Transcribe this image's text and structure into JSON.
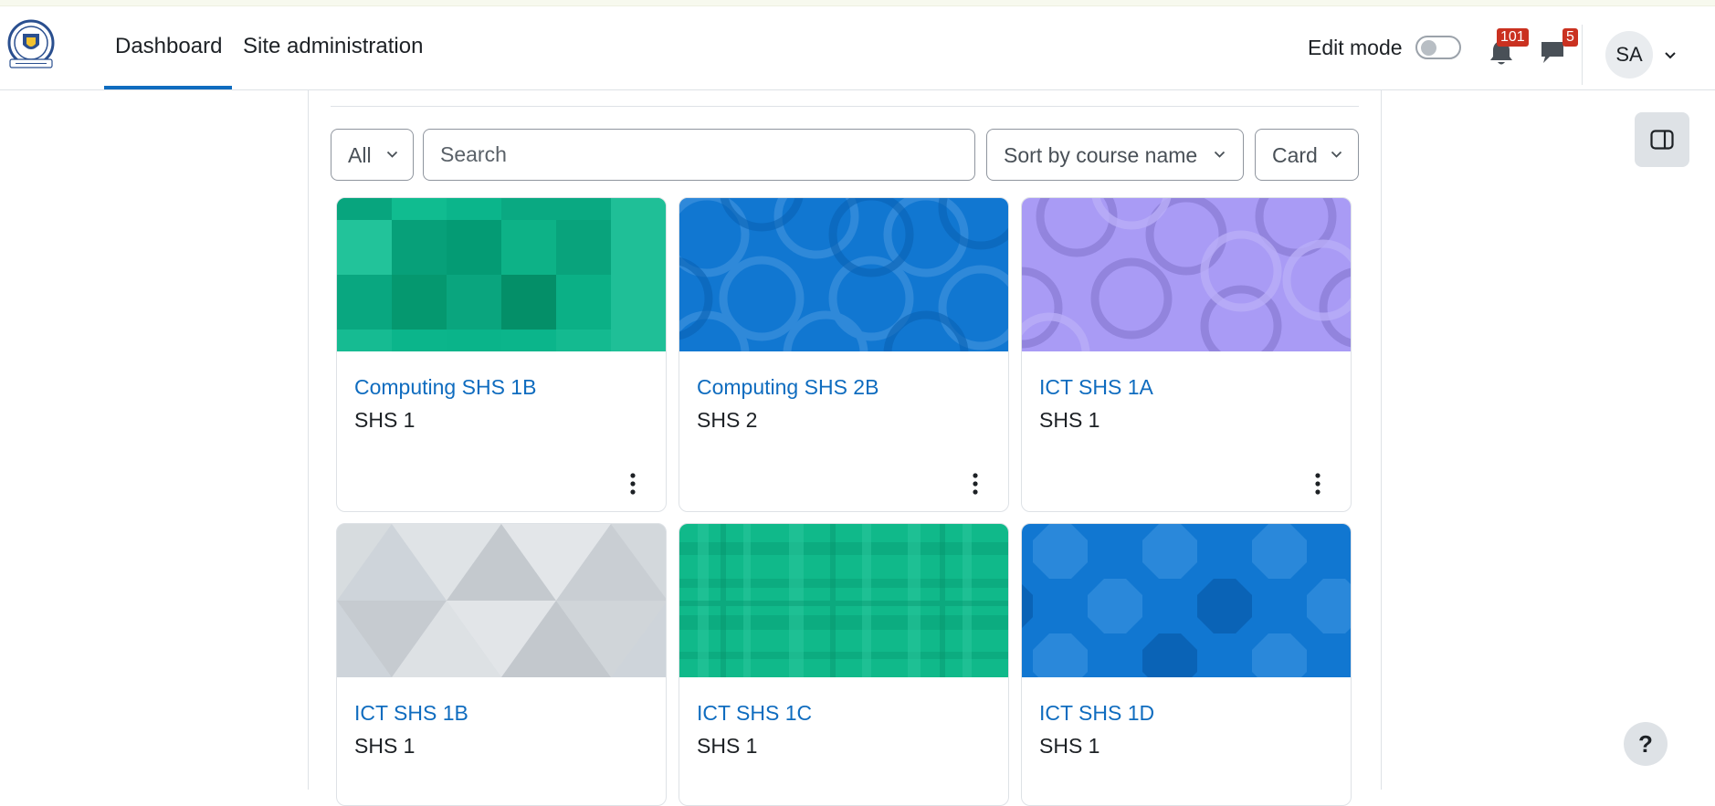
{
  "header": {
    "logo_icon": "school-crest-logo",
    "nav": [
      {
        "label": "Dashboard",
        "active": true
      },
      {
        "label": "Site administration",
        "active": false
      }
    ],
    "edit_mode_label": "Edit mode",
    "edit_mode_on": false,
    "notifications_count": "101",
    "messages_count": "5",
    "user_initials": "SA"
  },
  "filters": {
    "grouping": "All",
    "search_placeholder": "Search",
    "sort": "Sort by course name",
    "view": "Card"
  },
  "courses": [
    {
      "name": "Computing SHS 1B",
      "category": "SHS 1",
      "pattern": "squares-green",
      "color": "#0bb58b"
    },
    {
      "name": "Computing SHS 2B",
      "category": "SHS 2",
      "pattern": "rings-blue",
      "color": "#1177d1"
    },
    {
      "name": "ICT SHS 1A",
      "category": "SHS 1",
      "pattern": "rings-lavender",
      "color": "#a99bf5"
    },
    {
      "name": "ICT SHS 1B",
      "category": "SHS 1",
      "pattern": "triangles-grey",
      "color": "#ced4da"
    },
    {
      "name": "ICT SHS 1C",
      "category": "SHS 1",
      "pattern": "plaid-green",
      "color": "#10b98a"
    },
    {
      "name": "ICT SHS 1D",
      "category": "SHS 1",
      "pattern": "octagons-blue",
      "color": "#1177d1"
    }
  ],
  "colors": {
    "accent": "#0f6cbf",
    "badge": "#ca3120"
  },
  "help_label": "?"
}
